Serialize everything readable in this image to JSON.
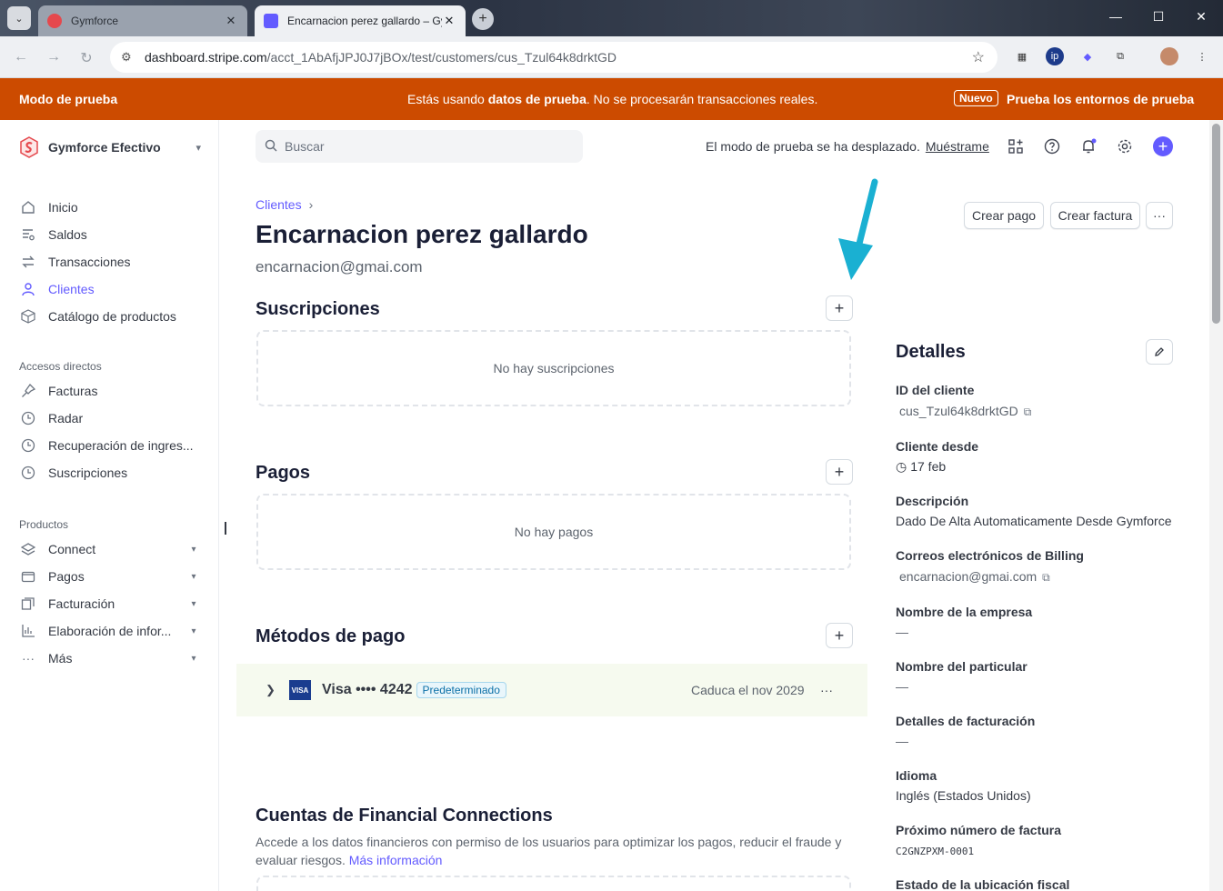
{
  "browser": {
    "tabs": [
      {
        "title": "Gymforce",
        "active": false
      },
      {
        "title": "Encarnacion perez gallardo – Gymforce",
        "active": true
      }
    ],
    "url_host": "dashboard.stripe.com",
    "url_path": "/acct_1AbAfjJPJ0J7jBOx/test/customers/cus_Tzul64k8drktGD"
  },
  "banner": {
    "left": "Modo de prueba",
    "center_prefix": "Estás usando ",
    "center_bold": "datos de prueba",
    "center_suffix": ". No se procesarán transacciones reales.",
    "badge": "Nuevo",
    "right": "Prueba los entornos de prueba"
  },
  "sidebar": {
    "account_name": "Gymforce Efectivo",
    "main": [
      {
        "label": "Inicio",
        "icon": "home-icon"
      },
      {
        "label": "Saldos",
        "icon": "balances-icon"
      },
      {
        "label": "Transacciones",
        "icon": "transactions-icon"
      },
      {
        "label": "Clientes",
        "icon": "customers-icon",
        "active": true
      },
      {
        "label": "Catálogo de productos",
        "icon": "box-icon"
      }
    ],
    "shortcuts_title": "Accesos directos",
    "shortcuts": [
      {
        "label": "Facturas",
        "icon": "pin-icon"
      },
      {
        "label": "Radar",
        "icon": "clock-icon"
      },
      {
        "label": "Recuperación de ingres...",
        "icon": "clock-icon"
      },
      {
        "label": "Suscripciones",
        "icon": "clock-icon"
      }
    ],
    "products_title": "Productos",
    "products": [
      {
        "label": "Connect",
        "icon": "layers-icon"
      },
      {
        "label": "Pagos",
        "icon": "wallet-icon"
      },
      {
        "label": "Facturación",
        "icon": "billing-icon"
      },
      {
        "label": "Elaboración de infor...",
        "icon": "chart-icon"
      },
      {
        "label": "Más",
        "icon": "dots-icon"
      }
    ]
  },
  "header": {
    "search_placeholder": "Buscar",
    "note": "El modo de prueba se ha desplazado.",
    "note_link": "Muéstrame"
  },
  "customer": {
    "breadcrumb": "Clientes",
    "name": "Encarnacion perez gallardo",
    "email": "encarnacion@gmai.com",
    "actions": {
      "create_payment": "Crear pago",
      "create_invoice": "Crear factura",
      "more": "···"
    }
  },
  "sections": {
    "subscriptions": {
      "title": "Suscripciones",
      "empty": "No hay suscripciones"
    },
    "payments": {
      "title": "Pagos",
      "empty": "No hay pagos"
    },
    "payment_methods": {
      "title": "Métodos de pago",
      "brand": "VISA",
      "card": "Visa •••• 4242",
      "default_badge": "Predeterminado",
      "expiry": "Caduca el nov 2029"
    },
    "financial_connections": {
      "title": "Cuentas de Financial Connections",
      "desc": "Accede a los datos financieros con permiso de los usuarios para optimizar los pagos, reducir el fraude y evaluar riesgos.",
      "link": "Más información"
    }
  },
  "details": {
    "title": "Detalles",
    "fields": [
      {
        "label": "ID del cliente",
        "value": "cus_Tzul64k8drktGD"
      },
      {
        "label": "Cliente desde",
        "value": "17 feb"
      },
      {
        "label": "Descripción",
        "value": "Dado De Alta Automaticamente Desde Gymforce"
      },
      {
        "label": "Correos electrónicos de Billing",
        "value": "encarnacion@gmai.com"
      },
      {
        "label": "Nombre de la empresa",
        "value": "—"
      },
      {
        "label": "Nombre del particular",
        "value": "—"
      },
      {
        "label": "Detalles de facturación",
        "value": "—"
      },
      {
        "label": "Idioma",
        "value": "Inglés (Estados Unidos)"
      },
      {
        "label": "Próximo número de factura",
        "value": "C2GNZPXM-0001"
      },
      {
        "label": "Estado de la ubicación fiscal",
        "value": ""
      }
    ]
  },
  "colors": {
    "accent": "#635bff",
    "banner": "#cc4b00",
    "annotation_arrow": "#1ab0d2"
  }
}
